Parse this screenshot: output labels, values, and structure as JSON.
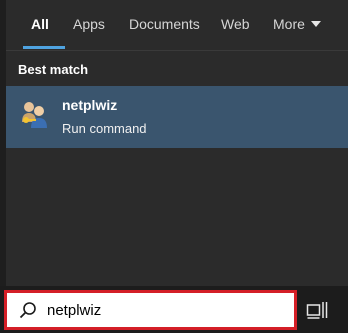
{
  "tabs": [
    {
      "label": "All",
      "active": true
    },
    {
      "label": "Apps"
    },
    {
      "label": "Documents"
    },
    {
      "label": "Web"
    },
    {
      "label": "More"
    }
  ],
  "best_match": {
    "heading": "Best match",
    "result": {
      "title": "netplwiz",
      "subtitle": "Run command",
      "icon": "users-icon"
    }
  },
  "taskbar": {
    "search": {
      "value": "netplwiz",
      "icon": "search-icon"
    },
    "taskview_icon": "task-view-icon"
  },
  "colors": {
    "panel_bg": "#2b2b2b",
    "selected_bg": "#3a556e",
    "accent": "#4fa3e0",
    "highlight_border": "#d41f27"
  }
}
